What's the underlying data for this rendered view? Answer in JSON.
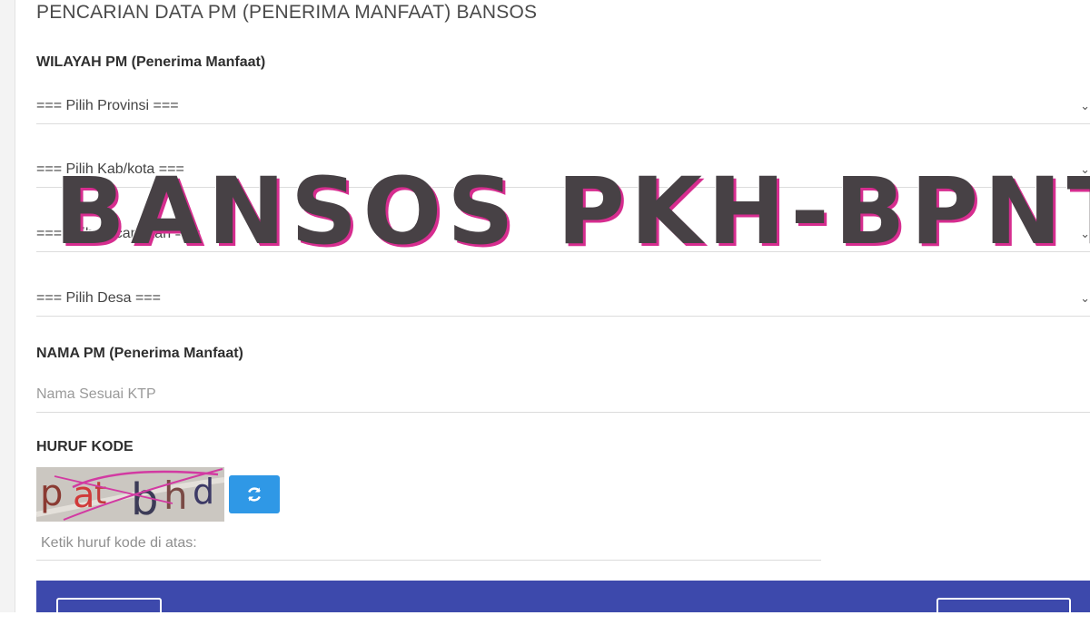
{
  "page": {
    "title": "PENCARIAN DATA PM (PENERIMA MANFAAT) BANSOS"
  },
  "wilayah": {
    "label": "WILAYAH PM (Penerima Manfaat)",
    "provinsi": "=== Pilih Provinsi ===",
    "kabkota": "=== Pilih Kab/kota ===",
    "kecamatan": "=== Pilih Kecamatan ===",
    "desa": "=== Pilih Desa ==="
  },
  "nama": {
    "label": "NAMA PM (Penerima Manfaat)",
    "placeholder": "Nama Sesuai KTP"
  },
  "kode": {
    "label": "HURUF KODE",
    "captcha_text": "patbhd",
    "input_placeholder": "Ketik huruf kode di atas:"
  },
  "overlay": {
    "text": "BANSOS PKH-BPNT"
  },
  "colors": {
    "accent_blue": "#2f98e6",
    "footer_bar": "#3d49ac",
    "overlay_text": "#474145",
    "overlay_shadow": "#d62d8f"
  },
  "icons": {
    "select_chevron": "chevron-down-icon",
    "refresh": "refresh-icon"
  }
}
